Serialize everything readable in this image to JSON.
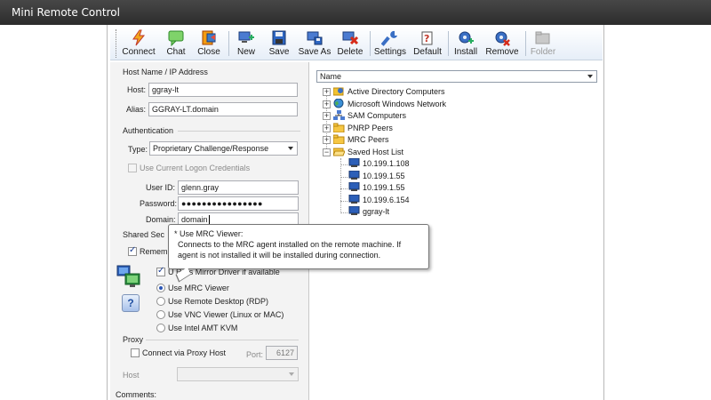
{
  "window": {
    "title": "Mini Remote Control"
  },
  "toolbar": {
    "connect": "Connect",
    "chat": "Chat",
    "close": "Close",
    "new": "New",
    "save": "Save",
    "save_as": "Save As",
    "delete": "Delete",
    "settings": "Settings",
    "default": "Default",
    "install": "Install",
    "remove": "Remove",
    "folder": "Folder"
  },
  "host_section": {
    "title": "Host Name / IP Address",
    "host_label": "Host:",
    "host_value": "ggray-lt",
    "alias_label": "Alias:",
    "alias_value": "GGRAY-LT.domain"
  },
  "auth": {
    "title": "Authentication",
    "type_label": "Type:",
    "type_value": "Proprietary Challenge/Response",
    "use_logon_label": "Use Current Logon Credentials",
    "userid_label": "User ID:",
    "userid_value": "glenn.gray",
    "password_label": "Password:",
    "password_value": "●●●●●●●●●●●●●●●●",
    "domain_label": "Domain:",
    "domain_value": "domain"
  },
  "shared": {
    "title_partial": "Shared Sec",
    "remember_partial": "Remem"
  },
  "viewer": {
    "mirror_driver_partial": "U       RC's Mirror Driver if available",
    "options": [
      "Use MRC Viewer",
      "Use Remote Desktop (RDP)",
      "Use VNC Viewer (Linux or MAC)",
      "Use Intel AMT KVM"
    ],
    "selected": "Use MRC Viewer",
    "help": "?"
  },
  "proxy": {
    "title": "Proxy",
    "connect_label": "Connect via Proxy Host",
    "port_label": "Port:",
    "port_value": "6127",
    "host_label": "Host"
  },
  "comments": {
    "label": "Comments:"
  },
  "tree": {
    "header": "Name",
    "roots": [
      {
        "label": "Active Directory Computers",
        "icon": "ad-computers-icon"
      },
      {
        "label": "Microsoft Windows Network",
        "icon": "network-globe-icon"
      },
      {
        "label": "SAM Computers",
        "icon": "sam-network-icon"
      },
      {
        "label": "PNRP Peers",
        "icon": "folder-icon"
      },
      {
        "label": "MRC Peers",
        "icon": "folder-icon"
      },
      {
        "label": "Saved Host List",
        "icon": "folder-open-icon"
      }
    ],
    "saved_hosts": [
      "10.199.1.108",
      "10.199.1.55",
      "10.199.1.55",
      "10.199.6.154",
      "ggray-lt"
    ]
  },
  "tooltip": {
    "title": "* Use MRC Viewer:",
    "line1": "Connects to the MRC agent installed on the remote machine. If",
    "line2": "agent is not installed it will be installed during connection."
  },
  "colors": {
    "titlebar": "#3a3a3a",
    "toolbar_bg": "#e6eef8",
    "accent_blue": "#2a55b5"
  }
}
